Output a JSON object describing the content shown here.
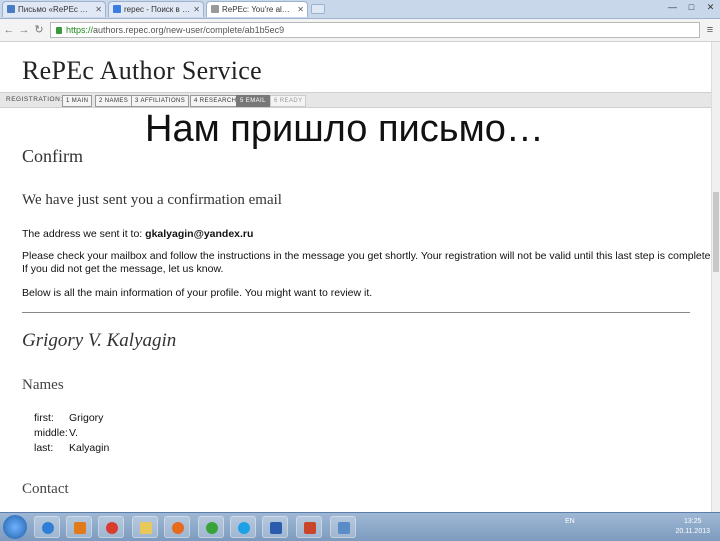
{
  "browser": {
    "tabs": [
      {
        "label": "Письмо «RePEc Author Se"
      },
      {
        "label": "repec - Поиск в Google"
      },
      {
        "label": "RePEc: You're almost done"
      }
    ],
    "address": {
      "scheme": "https://",
      "host_path": "authors.repec.org/new-user/complete/ab1b5ec9"
    },
    "window_controls": {
      "minimize": "—",
      "maximize": "□",
      "close": "✕"
    }
  },
  "page": {
    "site_title": "RePEc Author Service",
    "steps_label": "REGISTRATION:",
    "steps": [
      "1 MAIN",
      "2 NAMES",
      "3 AFFILIATIONS",
      "4 RESEARCH",
      "5 EMAIL",
      "6 READY"
    ],
    "overlay_caption": "Нам пришло письмо…",
    "confirm_heading": "Confirm",
    "sent_heading": "We have just sent you a confirmation email",
    "address_prefix": "The address we sent it to: ",
    "email": "gkalyagin@yandex.ru",
    "instructions_line1": "Please check your mailbox and follow the instructions in the message you get shortly. Your registration will not be valid until this last step is completed.",
    "instructions_line2": "If you did not get the message, let us know.",
    "below_text": "Below is all the main information of your profile. You might want to review it.",
    "profile_name": "Grigory V. Kalyagin",
    "names_heading": "Names",
    "names": [
      {
        "key": "first:",
        "value": "Grigory"
      },
      {
        "key": "middle:",
        "value": "V."
      },
      {
        "key": "last:",
        "value": "Kalyagin"
      }
    ],
    "contact_heading": "Contact"
  },
  "taskbar": {
    "language": "EN",
    "time": "13:25",
    "date": "20.11.2013",
    "icons": [
      "start-icon",
      "ie-icon",
      "media-player-icon",
      "chrome-icon",
      "file-explorer-icon",
      "firefox-icon",
      "icq-icon",
      "skype-icon",
      "word-icon",
      "powerpoint-icon",
      "picture-viewer-icon"
    ]
  },
  "colors": {
    "accent": "#1b8a1b",
    "taskbar": "#7d9bbf"
  }
}
